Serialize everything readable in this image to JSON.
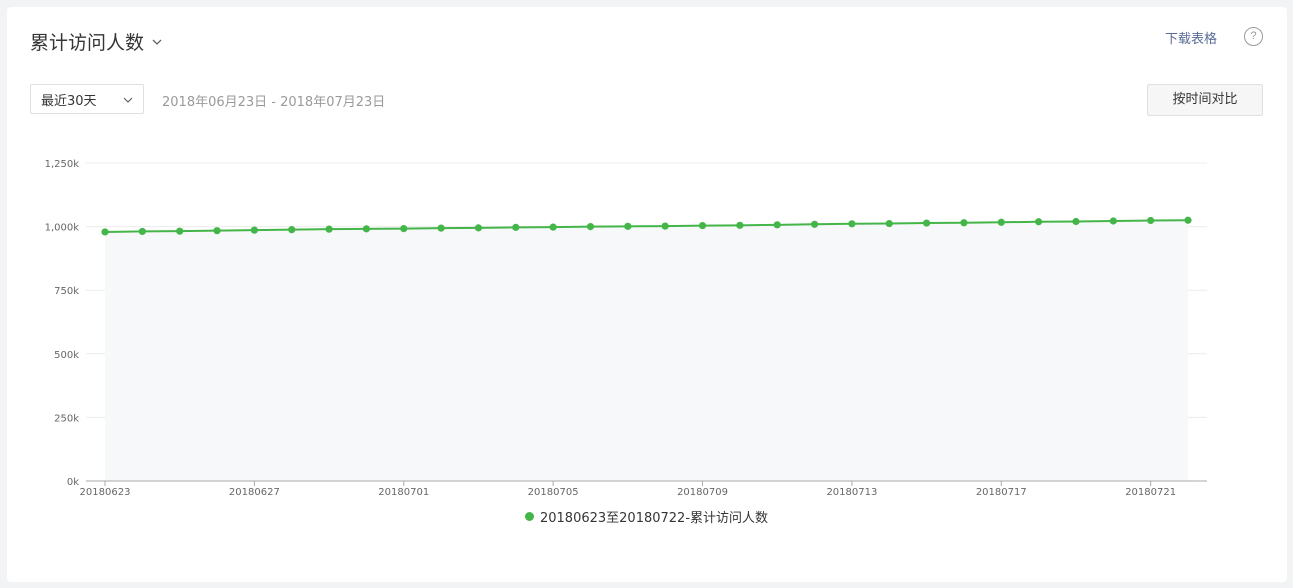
{
  "header": {
    "title": "累计访问人数",
    "download_label": "下载表格",
    "help_label": "?"
  },
  "filters": {
    "range_select": "最近30天",
    "date_range": "2018年06月23日 - 2018年07月23日",
    "compare_label": "按时间对比"
  },
  "colors": {
    "series": "#44b549",
    "area": "#f7f8fa",
    "link": "#576b95"
  },
  "chart_data": {
    "type": "line",
    "x": [
      "20180623",
      "20180624",
      "20180625",
      "20180626",
      "20180627",
      "20180628",
      "20180629",
      "20180630",
      "20180701",
      "20180702",
      "20180703",
      "20180704",
      "20180705",
      "20180706",
      "20180707",
      "20180708",
      "20180709",
      "20180710",
      "20180711",
      "20180712",
      "20180713",
      "20180714",
      "20180715",
      "20180716",
      "20180717",
      "20180718",
      "20180719",
      "20180720",
      "20180721",
      "20180722"
    ],
    "x_tick_labels": [
      "20180623",
      "20180627",
      "20180701",
      "20180705",
      "20180709",
      "20180713",
      "20180717",
      "20180721"
    ],
    "series": [
      {
        "name": "20180623至20180722-累计访问人数",
        "values": [
          979000,
          981000,
          982000,
          984000,
          986000,
          988000,
          990000,
          991000,
          992000,
          994000,
          995000,
          997000,
          998000,
          1000000,
          1001000,
          1002000,
          1004000,
          1005000,
          1007000,
          1009000,
          1011000,
          1012000,
          1014000,
          1015000,
          1017000,
          1019000,
          1020000,
          1022000,
          1024000,
          1025000
        ]
      }
    ],
    "y_ticks": [
      "0k",
      "250k",
      "500k",
      "750k",
      "1,000k",
      "1,250k"
    ],
    "ylim": [
      0,
      1250000
    ],
    "grid": true,
    "legend_position": "bottom-center"
  }
}
